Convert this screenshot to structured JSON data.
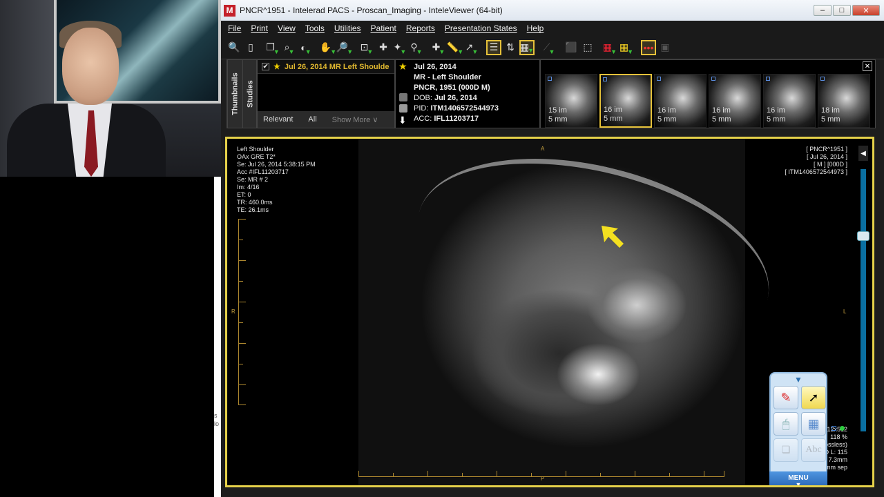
{
  "window": {
    "title": "PNCR^1951 - Intelerad PACS - Proscan_Imaging - InteleViewer (64-bit)",
    "controls": [
      "–",
      "□",
      "✕"
    ]
  },
  "menu": [
    "File",
    "Print",
    "View",
    "Tools",
    "Utilities",
    "Patient",
    "Reports",
    "Presentation States",
    "Help"
  ],
  "panels": {
    "tab_thumbnails": "Thumbnails",
    "tab_studies": "Studies"
  },
  "study_list": {
    "study_label": "Jul 26, 2014  MR  Left Shoulde",
    "filter_relevant": "Relevant",
    "filter_all": "All",
    "filter_more": "Show More ∨"
  },
  "study_info": {
    "date": "Jul 26, 2014",
    "description": "MR - Left Shoulder",
    "patient": "PNCR, 1951 (000D M)",
    "dob_label": "DOB:",
    "dob": "Jul 26, 2014",
    "pid_label": "PID:",
    "pid": "ITM1406572544973",
    "acc_label": "ACC:",
    "acc": "IFL11203717"
  },
  "thumbnails": [
    {
      "images": "15 im",
      "thickness": "5 mm",
      "selected": false
    },
    {
      "images": "16 im",
      "thickness": "5 mm",
      "selected": true
    },
    {
      "images": "16 im",
      "thickness": "5 mm",
      "selected": false
    },
    {
      "images": "16 im",
      "thickness": "5 mm",
      "selected": false
    },
    {
      "images": "16 im",
      "thickness": "5 mm",
      "selected": false
    },
    {
      "images": "18 im",
      "thickness": "5 mm",
      "selected": false
    }
  ],
  "overlay": {
    "top_left": "Left Shoulder\nOAx GRE T2*\nSe: Jul 26, 2014 5:38:15 PM\nAcc #IFL11203717\nSe: MR # 2\nIm: 4/16\nET: 0\nTR: 460.0ms\nTE: 26.1ms",
    "top_right": "[ PNCR^1951 ]\n[ Jul 26, 2014 ]\n[ M ] [000D ]\n[ ITM1406572544973 ]",
    "bottom_right": "512x512\n118 %\n(lossless)\nD L: 115\n7.3mm\n5mm sep",
    "orientation": {
      "top": "A",
      "left": "R",
      "right": "L",
      "bottom": "P"
    }
  },
  "float_menu": {
    "label": "MENU",
    "text_tool": "Abc"
  },
  "side_fragment": "s\nlo",
  "colors": {
    "viewport_border": "#e6d24a",
    "annotation_arrow": "#f4e020",
    "scroll_track": "#0a6fa0"
  }
}
